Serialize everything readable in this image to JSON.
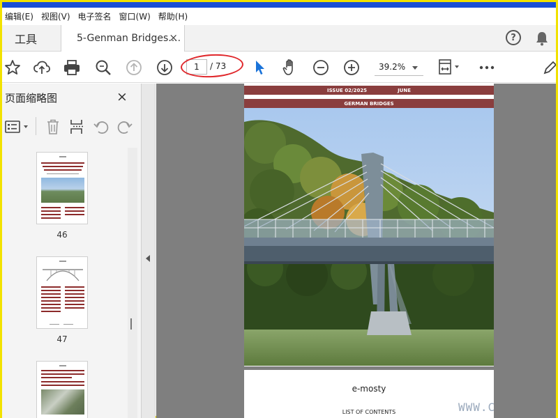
{
  "menubar": {
    "items": [
      "编辑(E)",
      "视图(V)",
      "电子签名",
      "窗口(W)",
      "帮助(H)"
    ]
  },
  "tabs": {
    "tools_label": "工具",
    "doc_label": "5-Genman Bridges....",
    "doc_close": "×"
  },
  "toolbar": {
    "page_current": "1",
    "page_total": "/ 73",
    "zoom": "39.2%"
  },
  "sidepanel": {
    "title": "页面缩略图",
    "close": "×",
    "thumbnails": [
      {
        "label": "46"
      },
      {
        "label": "47"
      },
      {
        "label": ""
      }
    ]
  },
  "document": {
    "page1": {
      "issue": "ISSUE 02/2025",
      "month": "JUNE",
      "section": "GERMAN BRIDGES"
    },
    "page2": {
      "logo": "e-mosty",
      "toc_heading": "LIST OF CONTENTS"
    }
  },
  "watermark": {
    "bottom_right": "WWW.C"
  },
  "colors": {
    "accent_blue": "#1a4fd6",
    "header_maroon": "#8a3e3e",
    "annotation_red": "#e0272b",
    "frame_yellow": "#f2e200"
  }
}
